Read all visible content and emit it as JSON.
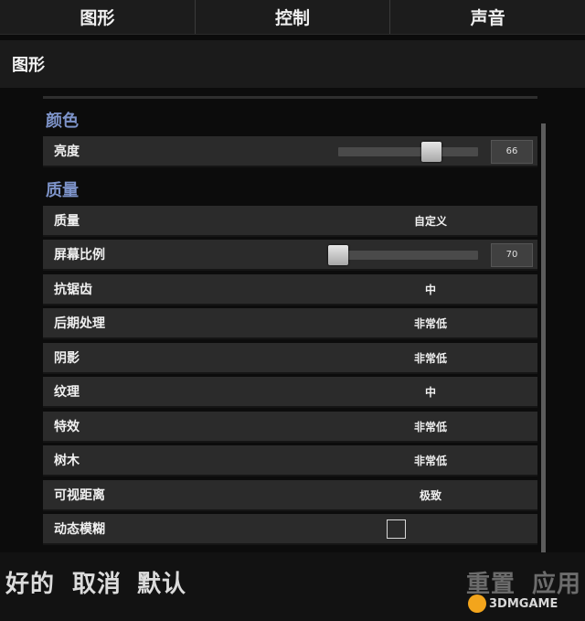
{
  "tabs": [
    {
      "label": "图形"
    },
    {
      "label": "控制"
    },
    {
      "label": "声音"
    }
  ],
  "page_title": "图形",
  "groups": {
    "color": "颜色",
    "quality": "质量"
  },
  "rows": {
    "brightness": {
      "label": "亮度",
      "value": "66",
      "level": 0.66
    },
    "quality": {
      "label": "质量",
      "value": "自定义"
    },
    "screen_scale": {
      "label": "屏幕比例",
      "value": "70",
      "level": 0.0
    },
    "antialiasing": {
      "label": "抗锯齿",
      "value": "中"
    },
    "post_processing": {
      "label": "后期处理",
      "value": "非常低"
    },
    "shadows": {
      "label": "阴影",
      "value": "非常低"
    },
    "textures": {
      "label": "纹理",
      "value": "中"
    },
    "effects": {
      "label": "特效",
      "value": "非常低"
    },
    "foliage": {
      "label": "树木",
      "value": "非常低"
    },
    "view_distance": {
      "label": "可视距离",
      "value": "极致"
    },
    "motion_blur": {
      "label": "动态模糊",
      "checked": false
    }
  },
  "footer": {
    "ok": "好的",
    "cancel": "取消",
    "default": "默认",
    "reset": "重置",
    "apply": "应用"
  },
  "watermark": "3DMGAME",
  "colors": {
    "group_heading": "#7d93c9",
    "row_bg": "#2b2b2b",
    "disabled_button": "#6c6c6c"
  }
}
